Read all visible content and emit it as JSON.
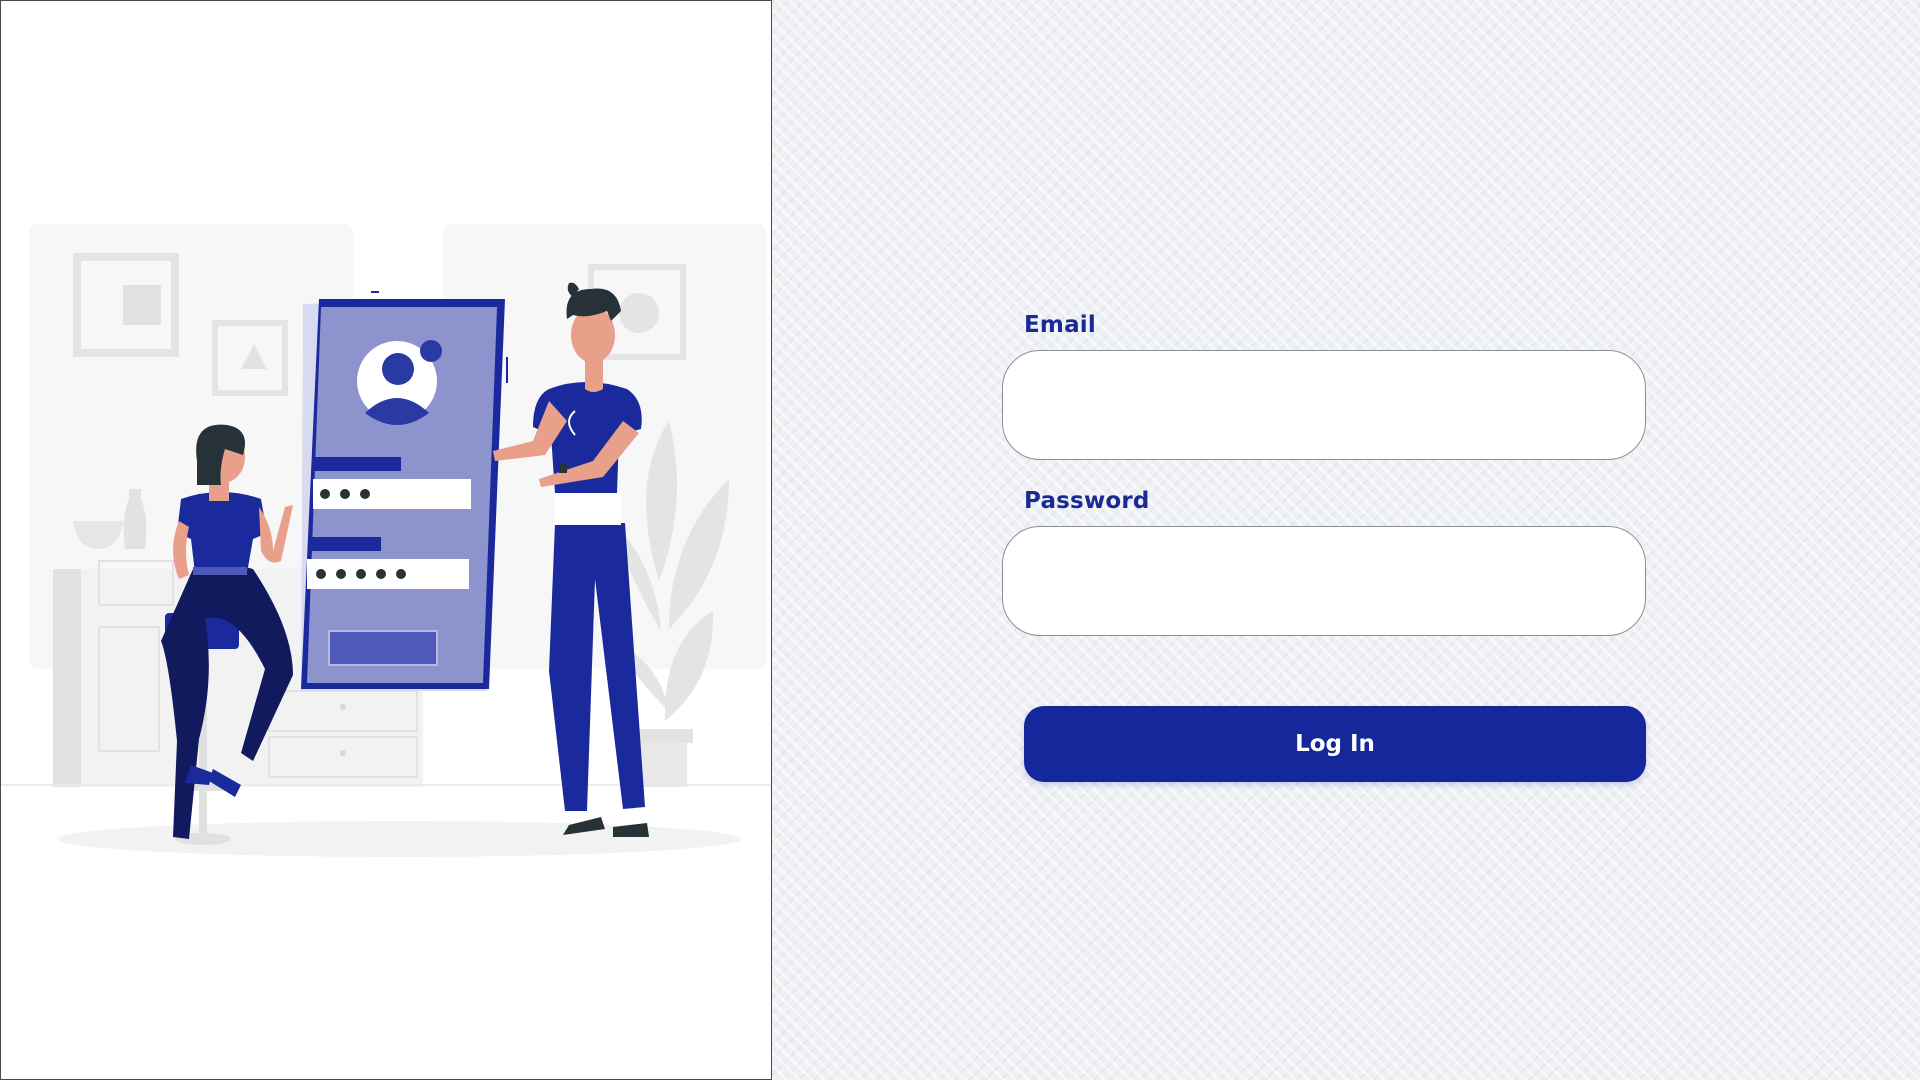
{
  "illustration": {
    "name": "login-illustration",
    "colors": {
      "primary": "#1a2a9c",
      "phone_fill": "#8c93cd",
      "skin": "#e8a08a",
      "hair": "#263238",
      "gray": "#e2e2e2"
    }
  },
  "form": {
    "email_label": "Email",
    "email_value": "",
    "password_label": "Password",
    "password_value": "",
    "submit_label": "Log In"
  },
  "colors": {
    "accent": "#14279b",
    "label": "#1a2a94",
    "background": "#eef0f3"
  }
}
